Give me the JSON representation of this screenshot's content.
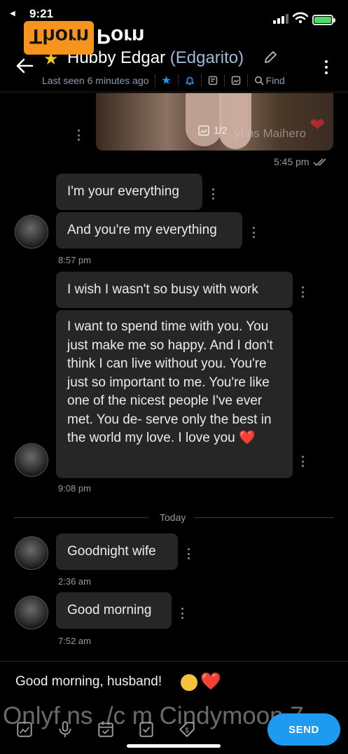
{
  "status_bar": {
    "time": "9:21",
    "back_glyph": "◀",
    "accent": "#4cd964"
  },
  "watermark": {
    "logo_part1": "Thorn",
    "logo_part2": "Porn",
    "bottom_text": "Onlyf ns ./c m Cindymoon 7"
  },
  "header": {
    "name": "Hubby Edgar",
    "nickname": "(Edgarito)",
    "last_seen": "Last seen 6 minutes ago",
    "find_label": "Find",
    "icons": [
      "back-arrow-icon",
      "star-icon",
      "pencil-icon",
      "bell-icon",
      "notes-icon",
      "media-icon",
      "search-icon",
      "more-icon"
    ]
  },
  "media_message": {
    "counter": "1/2",
    "watermark": "yf ns Maihero",
    "time": "5:45 pm"
  },
  "messages": [
    {
      "text": "I'm your everything"
    },
    {
      "text": "And you're my everything",
      "time": "8:57 pm"
    },
    {
      "text": "I wish I wasn't so busy with work"
    },
    {
      "text": "I want to spend time with you. You just make me so happy. And I don't think I can live without you. You're just so important to me. You're like one of the nicest people I've ever met. You de- serve only the best in the world my love. I love you",
      "emoji": "❤️",
      "time": "9:08 pm"
    },
    {
      "text": "Goodnight wife",
      "time": "2:36 am"
    },
    {
      "text": "Good morning",
      "time": "7:52 am"
    }
  ],
  "divider": {
    "label": "Today"
  },
  "compose": {
    "value": "Good morning, husband!",
    "emoji_heart": "❤️",
    "send_label": "SEND",
    "tools": [
      "image-icon",
      "microphone-icon",
      "calendar-icon",
      "checklist-icon",
      "price-tag-icon"
    ]
  }
}
